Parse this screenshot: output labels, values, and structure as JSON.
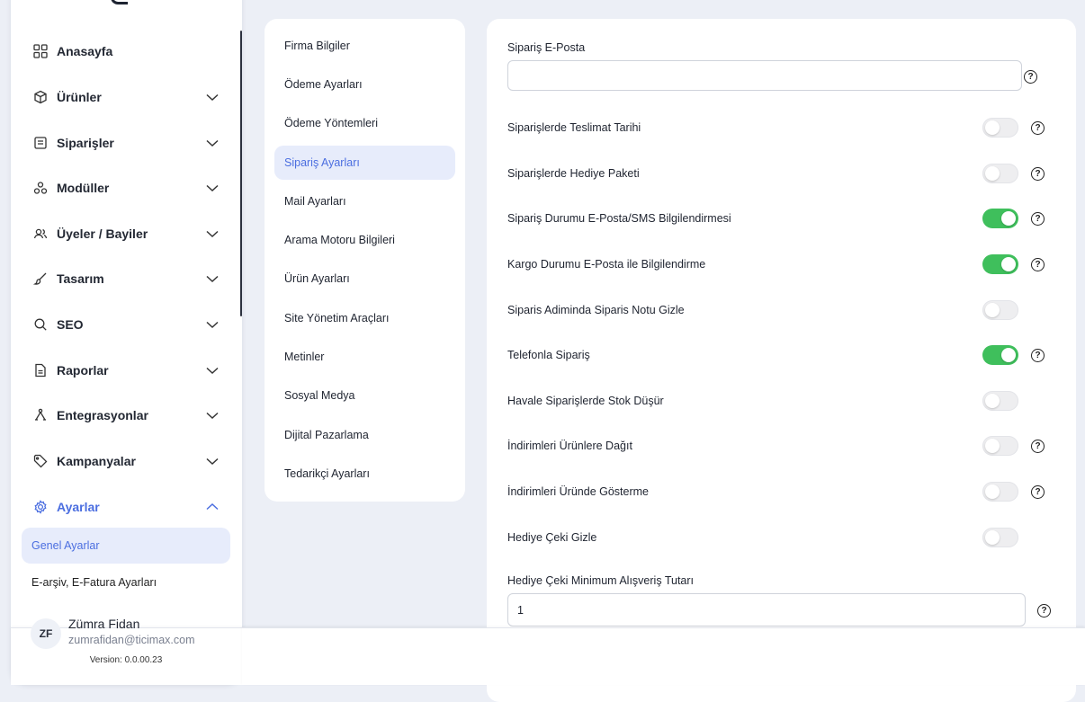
{
  "sidebar": {
    "items": [
      {
        "label": "Anasayfa",
        "icon": "grid-icon",
        "has_chevron": false
      },
      {
        "label": "Ürünler",
        "icon": "box-icon",
        "has_chevron": true
      },
      {
        "label": "Siparişler",
        "icon": "receipt-icon",
        "has_chevron": true
      },
      {
        "label": "Modüller",
        "icon": "modules-icon",
        "has_chevron": true
      },
      {
        "label": "Üyeler / Bayiler",
        "icon": "users-icon",
        "has_chevron": true
      },
      {
        "label": "Tasarım",
        "icon": "brush-icon",
        "has_chevron": true
      },
      {
        "label": "SEO",
        "icon": "search-icon",
        "has_chevron": true
      },
      {
        "label": "Raporlar",
        "icon": "report-icon",
        "has_chevron": true
      },
      {
        "label": "Entegrasyonlar",
        "icon": "integration-icon",
        "has_chevron": true
      },
      {
        "label": "Kampanyalar",
        "icon": "tag-icon",
        "has_chevron": true
      },
      {
        "label": "Ayarlar",
        "icon": "gear-icon",
        "has_chevron": true,
        "expanded": true,
        "active": true
      }
    ],
    "sub_items": [
      {
        "label": "Genel Ayarlar",
        "active": true
      },
      {
        "label": "E-arşiv, E-Fatura Ayarları",
        "active": false
      }
    ],
    "user": {
      "initials": "ZF",
      "name": "Zümra Fidan",
      "email": "zumrafidan@ticimax.com"
    },
    "version": "Version: 0.0.00.23"
  },
  "settings_menu": {
    "items": [
      {
        "label": "Firma Bilgiler"
      },
      {
        "label": "Ödeme Ayarları"
      },
      {
        "label": "Ödeme Yöntemleri"
      },
      {
        "label": "Sipariş Ayarları",
        "active": true
      },
      {
        "label": "Mail Ayarları"
      },
      {
        "label": "Arama Motoru Bilgileri"
      },
      {
        "label": "Ürün Ayarları"
      },
      {
        "label": "Site Yönetim Araçları"
      },
      {
        "label": "Metinler"
      },
      {
        "label": "Sosyal Medya"
      },
      {
        "label": "Dijital Pazarlama"
      },
      {
        "label": "Tedarikçi Ayarları"
      }
    ]
  },
  "order_settings": {
    "email_field": {
      "label": "Sipariş E-Posta",
      "value": ""
    },
    "toggles": [
      {
        "label": "Siparişlerde Teslimat Tarihi",
        "on": false,
        "help": true
      },
      {
        "label": "Siparişlerde Hediye Paketi",
        "on": false,
        "help": true
      },
      {
        "label": "Sipariş Durumu E-Posta/SMS Bilgilendirmesi",
        "on": true,
        "help": true
      },
      {
        "label": "Kargo Durumu E-Posta ile Bilgilendirme",
        "on": true,
        "help": true
      },
      {
        "label": "Siparis Adiminda Siparis Notu Gizle",
        "on": false,
        "help": false
      },
      {
        "label": "Telefonla Sipariş",
        "on": true,
        "help": true
      },
      {
        "label": "Havale Siparişlerde Stok Düşür",
        "on": false,
        "help": false
      },
      {
        "label": "İndirimleri Ürünlere Dağıt",
        "on": false,
        "help": true
      },
      {
        "label": "İndirimleri Üründe Gösterme",
        "on": false,
        "help": true
      },
      {
        "label": "Hediye Çeki Gizle",
        "on": false,
        "help": false
      }
    ],
    "min_amount_field": {
      "label": "Hediye Çeki Minimum Alışveriş Tutarı",
      "value": "1"
    },
    "help_glyph": "?"
  },
  "colors": {
    "accent": "#4b6ee0",
    "toggle_on": "#3fbf5c",
    "active_bg": "#e7ecfb"
  }
}
